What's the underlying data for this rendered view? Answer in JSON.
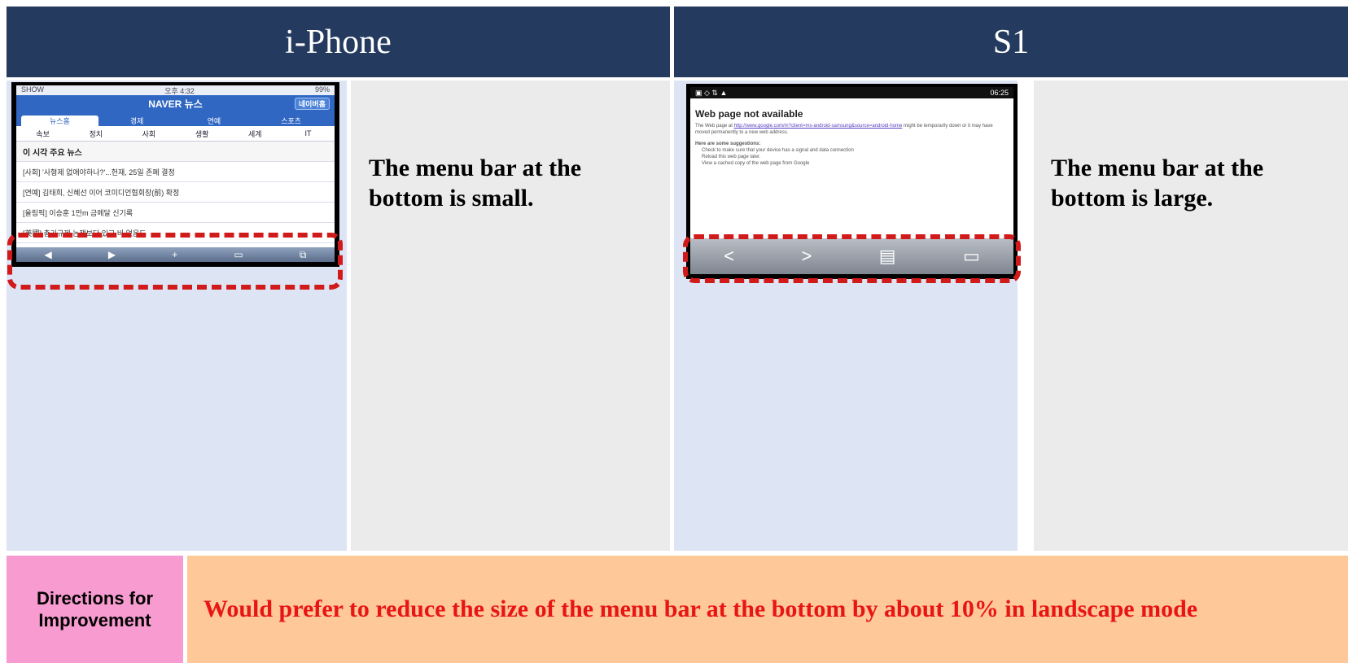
{
  "headers": {
    "left": "i-Phone",
    "right": "S1"
  },
  "iphone": {
    "description": "The menu bar at the bottom is small.",
    "status_left": "SHOW",
    "status_center": "오후 4:32",
    "status_right": "99%",
    "app_title": "NAVER 뉴스",
    "pill": "네이버홈",
    "tabs": [
      "뉴스홈",
      "경제",
      "연예",
      "스포츠"
    ],
    "subtabs": [
      "속보",
      "정치",
      "사회",
      "생활",
      "세계",
      "IT"
    ],
    "section_head": "이 시각 주요 뉴스",
    "rows": [
      "[사회] '사형제 없애야하나?'...헌재, 25일 존폐 결정",
      "[연예] 김태희, 신혜선 이어 코미디언협회장(前) 확정",
      "[올림픽] 이승훈 1만m 금메달 신기록",
      "[美國] 총기규제 논쟁보다 있고 비 없음도"
    ],
    "bar_icons": [
      "◀",
      "▶",
      "+",
      "▭",
      "⧉"
    ]
  },
  "s1": {
    "description": "The menu bar at the bottom is large.",
    "status_time": "06:25",
    "page_title": "Web page not available",
    "body_prefix": "The Web page at",
    "body_link": "http://www.google.com/m?client=ms-android-samsung&source=android-home",
    "body_suffix": "might be temporarily down or it may have moved permanently to a new web address.",
    "suggest_head": "Here are some suggestions:",
    "suggestions": [
      "Check to make sure that your device has a signal and data connection",
      "Reload this web page later.",
      "View a cached copy of the web page from Google"
    ],
    "bar_icons": [
      "<",
      ">",
      "▤",
      "▭"
    ]
  },
  "directions": {
    "label_line1": "Directions for",
    "label_line2": "Improvement",
    "text": "Would prefer to reduce the size of the menu bar at the bottom by about 10% in landscape mode"
  },
  "colors": {
    "header_bg": "#243a5e",
    "dash_red": "#d11b1b",
    "label_pink": "#f79bd0",
    "band_orange": "#fec898",
    "direction_text": "#e81515"
  }
}
